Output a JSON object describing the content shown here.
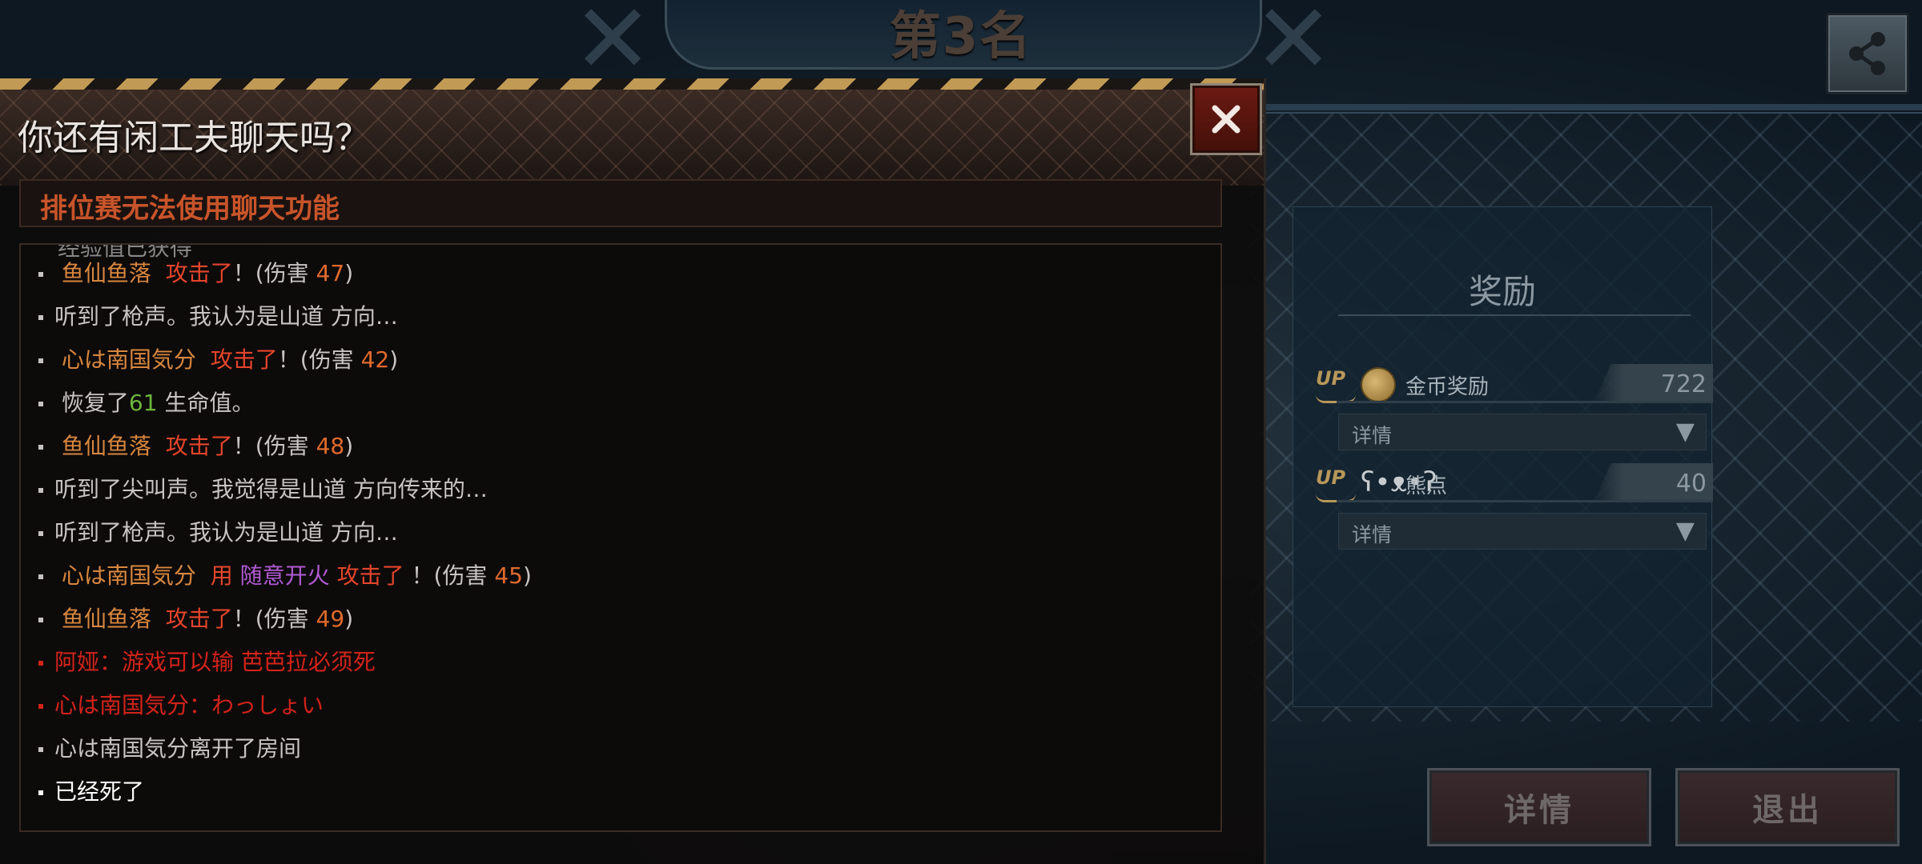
{
  "rank": {
    "title": "第3名"
  },
  "chat": {
    "title": "你还有闲工夫聊天吗？",
    "notice": "排位赛无法使用聊天功能",
    "cutoff_text": "经验值已获得",
    "lines": [
      {
        "player": "鱼仙鱼落",
        "action": "攻击了",
        "mid": "！(伤害 ",
        "damage": "47",
        "end": ")"
      },
      {
        "text": "听到了枪声。我认为是山道 方向…"
      },
      {
        "player": "心は南国気分",
        "action": "攻击了",
        "mid": "！(伤害 ",
        "damage": "42",
        "end": ")"
      },
      {
        "pre": "恢复了",
        "amount": "61",
        "post": " 生命值。"
      },
      {
        "player": "鱼仙鱼落",
        "action": "攻击了",
        "mid": "！(伤害 ",
        "damage": "48",
        "end": ")"
      },
      {
        "text": "听到了尖叫声。我觉得是山道 方向传来的…"
      },
      {
        "text": "听到了枪声。我认为是山道 方向…"
      },
      {
        "player": "心は南国気分",
        "use": "用",
        "weapon": "随意开火",
        "action": "攻击了",
        "mid": " ！(伤害 ",
        "damage": "45",
        "end": ")"
      },
      {
        "player": "鱼仙鱼落",
        "action": "攻击了",
        "mid": "！(伤害 ",
        "damage": "49",
        "end": ")"
      },
      {
        "text": "阿娅：游戏可以输 芭芭拉必须死"
      },
      {
        "text": "心は南国気分：わっしょい"
      },
      {
        "text": "心は南国気分离开了房间"
      },
      {
        "text": "已经死了"
      }
    ]
  },
  "reward": {
    "title": "奖励",
    "up_label": "UP",
    "rows": [
      {
        "label": "金币奖励",
        "value": "722",
        "detail": "详情",
        "icon": "coin-icon"
      },
      {
        "label": "熊点",
        "value": "40",
        "detail": "详情",
        "icon": "bear-points-icon"
      }
    ],
    "arrow": "▼"
  },
  "buttons": {
    "details": "详情",
    "exit": "退出"
  },
  "colors": {
    "accent_orange": "#d8873e",
    "damage": "#e06a2c",
    "chat_red": "#d2231a",
    "heal_green": "#6ab53a",
    "weapon_purple": "#b05ad2",
    "notice": "#c8542a"
  }
}
